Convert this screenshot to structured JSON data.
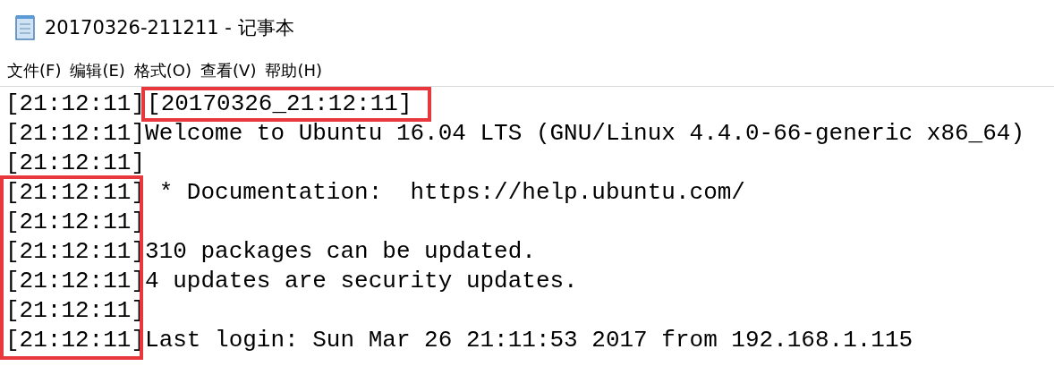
{
  "window": {
    "title": "20170326-211211 - 记事本"
  },
  "menu": [
    {
      "label": "文件(F)"
    },
    {
      "label": "编辑(E)"
    },
    {
      "label": "格式(O)"
    },
    {
      "label": "查看(V)"
    },
    {
      "label": "帮助(H)"
    }
  ],
  "lines": [
    {
      "timestamp": "[21:12:11]",
      "timestamp_highlighted": false,
      "text": "[20170326_21:12:11]",
      "text_highlighted": true
    },
    {
      "timestamp": "[21:12:11]",
      "timestamp_highlighted": false,
      "text": "Welcome to Ubuntu 16.04 LTS (GNU/Linux 4.4.0-66-generic x86_64)",
      "text_highlighted": false
    },
    {
      "timestamp": "[21:12:11]",
      "timestamp_highlighted": false
    },
    {
      "timestamp": "[21:12:11]",
      "timestamp_highlighted": true,
      "text": " * Documentation:  https://help.ubuntu.com/",
      "text_highlighted": false
    },
    {
      "timestamp": "[21:12:11]",
      "timestamp_highlighted": true
    },
    {
      "timestamp": "[21:12:11]",
      "timestamp_highlighted": true,
      "text": "310 packages can be updated.",
      "text_highlighted": false
    },
    {
      "timestamp": "[21:12:11]",
      "timestamp_highlighted": true,
      "text": "4 updates are security updates.",
      "text_highlighted": false
    },
    {
      "timestamp": "[21:12:11]",
      "timestamp_highlighted": true
    },
    {
      "timestamp": "[21:12:11]",
      "timestamp_highlighted": true,
      "text": "Last login: Sun Mar 26 21:11:53 2017 from 192.168.1.115",
      "text_highlighted": false
    }
  ]
}
